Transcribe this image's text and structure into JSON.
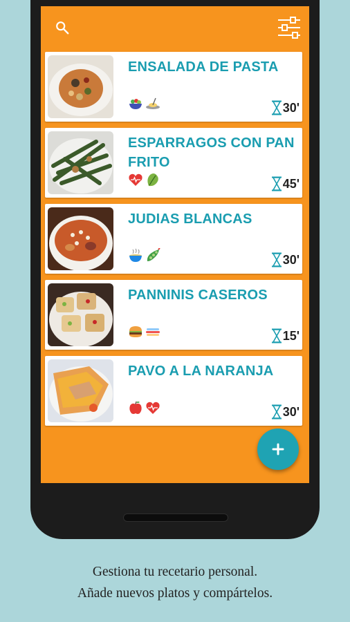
{
  "recipes": [
    {
      "title": "ENSALADA DE PASTA",
      "time": "30'",
      "tags": [
        "salad-bowl-icon",
        "pasta-plate-icon"
      ]
    },
    {
      "title": "ESPARRAGOS CON PAN FRITO",
      "time": "45'",
      "tags": [
        "heart-health-icon",
        "lettuce-icon"
      ]
    },
    {
      "title": "JUDIAS BLANCAS",
      "time": "30'",
      "tags": [
        "stew-bowl-icon",
        "pea-pod-icon"
      ]
    },
    {
      "title": "PANNINIS CASEROS",
      "time": "15'",
      "tags": [
        "burger-icon",
        "sandwich-icon"
      ]
    },
    {
      "title": "PAVO A LA NARANJA",
      "time": "30'",
      "tags": [
        "apple-icon",
        "heart-health-icon"
      ]
    }
  ],
  "caption": {
    "line1": "Gestiona tu recetario personal.",
    "line2": "Añade nuevos platos y compártelos."
  },
  "fab": {
    "label": "+"
  },
  "colors": {
    "accent": "#f7941e",
    "title": "#1a9db0",
    "fab": "#1fa3b3",
    "background": "#acd6da"
  }
}
